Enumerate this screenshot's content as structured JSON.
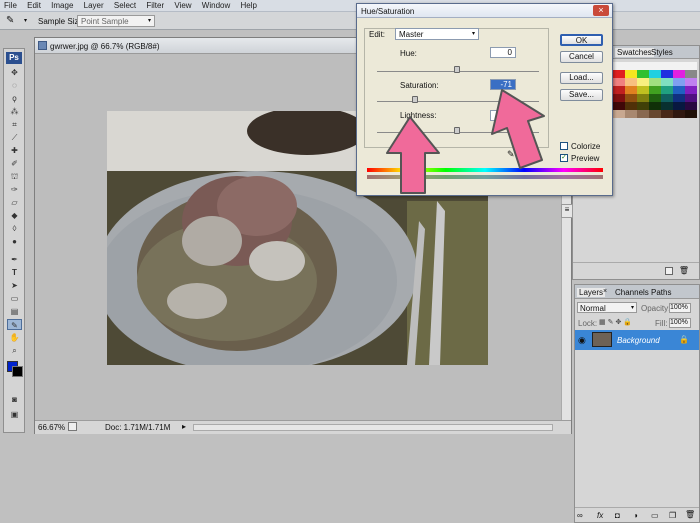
{
  "menu": [
    "File",
    "Edit",
    "Image",
    "Layer",
    "Select",
    "Filter",
    "View",
    "Window",
    "Help"
  ],
  "options_bar": {
    "sample_size_label": "Sample Size:",
    "sample_size_value": "Point Sample"
  },
  "toolbox": {
    "logo": "Ps"
  },
  "document": {
    "title": "gwrwer.jpg @ 66.7% (RGB/8#)",
    "zoom": "66.67%",
    "doc_info": "Doc: 1.71M/1.71M"
  },
  "dialog": {
    "title": "Hue/Saturation",
    "edit_label": "Edit:",
    "edit_value": "Master",
    "hue_label": "Hue:",
    "hue_value": "0",
    "saturation_label": "Saturation:",
    "saturation_value": "-71",
    "lightness_label": "Lightness:",
    "lightness_value": "0",
    "ok": "OK",
    "cancel": "Cancel",
    "load": "Load...",
    "save": "Save...",
    "colorize": "Colorize",
    "preview": "Preview",
    "preview_checked": true,
    "colorize_checked": false
  },
  "swatches_panel": {
    "tabs": [
      "Swatches",
      "Styles"
    ]
  },
  "layers_panel": {
    "tabs": [
      "Layers",
      "Channels",
      "Paths"
    ],
    "blend_mode": "Normal",
    "opacity_label": "Opacity:",
    "opacity_value": "100%",
    "lock_label": "Lock:",
    "fill_label": "Fill:",
    "fill_value": "100%",
    "layer_name": "Background"
  },
  "colors": {
    "annotation_arrow": "#f06a9a",
    "selection_blue": "#3a86d6",
    "foreground": "#0022cc",
    "background": "#000000"
  }
}
